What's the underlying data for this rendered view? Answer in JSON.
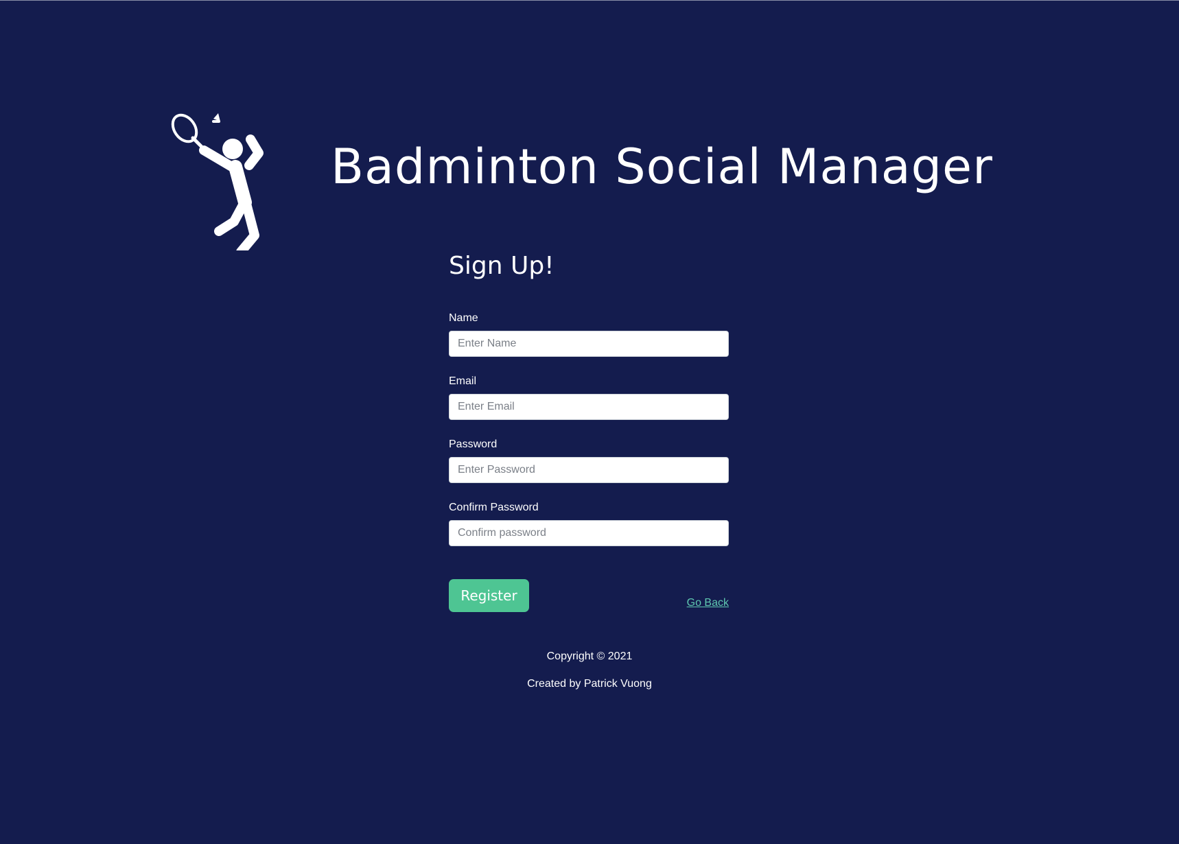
{
  "header": {
    "logo_icon": "badminton-player-icon",
    "title": "Badminton Social Manager"
  },
  "form": {
    "heading": "Sign Up!",
    "fields": [
      {
        "label": "Name",
        "placeholder": "Enter Name",
        "value": ""
      },
      {
        "label": "Email",
        "placeholder": "Enter Email",
        "value": ""
      },
      {
        "label": "Password",
        "placeholder": "Enter Password",
        "value": ""
      },
      {
        "label": "Confirm Password",
        "placeholder": "Confirm password",
        "value": ""
      }
    ],
    "register_label": "Register",
    "go_back_label": "Go Back"
  },
  "footer": {
    "copyright": "Copyright © 2021",
    "credit": "Created by Patrick Vuong"
  },
  "colors": {
    "background": "#141c4e",
    "accent": "#4ec593",
    "link": "#5fc8b0"
  }
}
